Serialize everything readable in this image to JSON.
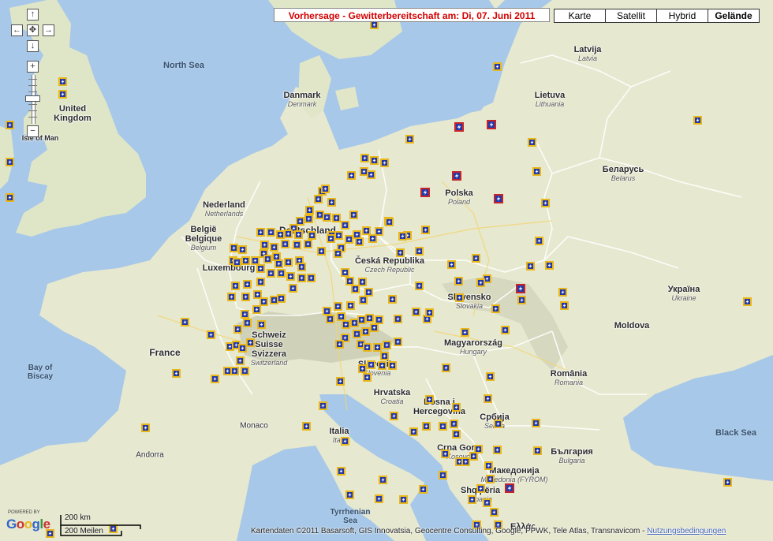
{
  "forecast_title": "Vorhersage - Gewitterbereitschaft am: Di, 07. Juni 2011",
  "map_types": [
    "Karte",
    "Satellit",
    "Hybrid",
    "Gelände"
  ],
  "active_map_type": "Gelände",
  "controls": {
    "pan_up": "↑",
    "pan_left": "←",
    "pan_center": "✥",
    "pan_right": "→",
    "pan_down": "↓",
    "zoom_in": "+",
    "zoom_out": "−"
  },
  "labels": {
    "north_sea": "North Sea",
    "uk": "United\nKingdom",
    "isle_of_man": "Isle of Man",
    "danmark": {
      "name": "Danmark",
      "sub": "Denmark"
    },
    "latvija": {
      "name": "Latvija",
      "sub": "Latvia"
    },
    "lietuva": {
      "name": "Lietuva",
      "sub": "Lithuania"
    },
    "belarus": {
      "name": "Беларусь",
      "sub": "Belarus"
    },
    "nederland": {
      "name": "Nederland",
      "sub": "Netherlands"
    },
    "belgie": {
      "name": "België\nBelgique",
      "sub": "Belgium"
    },
    "luxembourg": "Luxembourg",
    "deutschland": "Deutschland",
    "polska": {
      "name": "Polska",
      "sub": "Poland"
    },
    "cesko": {
      "name": "Česká Republika",
      "sub": "Czech Republic"
    },
    "slovensko": {
      "name": "Slovensko",
      "sub": "Slovakia"
    },
    "ukraina": {
      "name": "Україна",
      "sub": "Ukraine"
    },
    "moldova": "Moldova",
    "schweiz": {
      "name": "Schweiz\nSuisse\nSvizzera",
      "sub": "Switzerland"
    },
    "france": "France",
    "bay_of_biscay": "Bay of\nBiscay",
    "magyarorszag": {
      "name": "Magyarország",
      "sub": "Hungary"
    },
    "romania": {
      "name": "România",
      "sub": "Romania"
    },
    "slovenija": {
      "name": "Slovenija",
      "sub": "Slovenia"
    },
    "hrvatska": {
      "name": "Hrvatska",
      "sub": "Croatia"
    },
    "bosna": {
      "name": "Bosna i\nHercegovina",
      "sub": ""
    },
    "srbija": {
      "name": "Србија",
      "sub": "Serbia"
    },
    "monaco": "Monaco",
    "italia": {
      "name": "Italia",
      "sub": "Italy"
    },
    "andorra": "Andorra",
    "crna_gora": {
      "name": "Crna Gora",
      "sub": "Kosovo"
    },
    "balgaria": {
      "name": "България",
      "sub": "Bulgaria"
    },
    "makedonija": {
      "name": "Македонија",
      "sub": "Macedonia (FYROM)"
    },
    "shqiperia": {
      "name": "Shqipëria",
      "sub": "Albania"
    },
    "black_sea": "Black Sea",
    "tyrrhenian": "Tyrrhenian\nSea",
    "ellas": "Ελλάς"
  },
  "scale": {
    "km": "200 km",
    "mi": "200 Meilen"
  },
  "google": {
    "powered": "POWERED BY",
    "logo": "Google"
  },
  "attribution": "Kartendaten ©2011 Basarsoft, GIS Innovatsia, Geocentre Consulting, Google, PPWK, Tele Atlas, Transnavicom - ",
  "terms_link": "Nutzungsbedingungen",
  "colors": {
    "marker_border": "#e8b71a",
    "marker_fill": "#2438a8",
    "marker_high": "#c4242a",
    "title_red": "#d20000"
  },
  "icon": "lightning-icon"
}
